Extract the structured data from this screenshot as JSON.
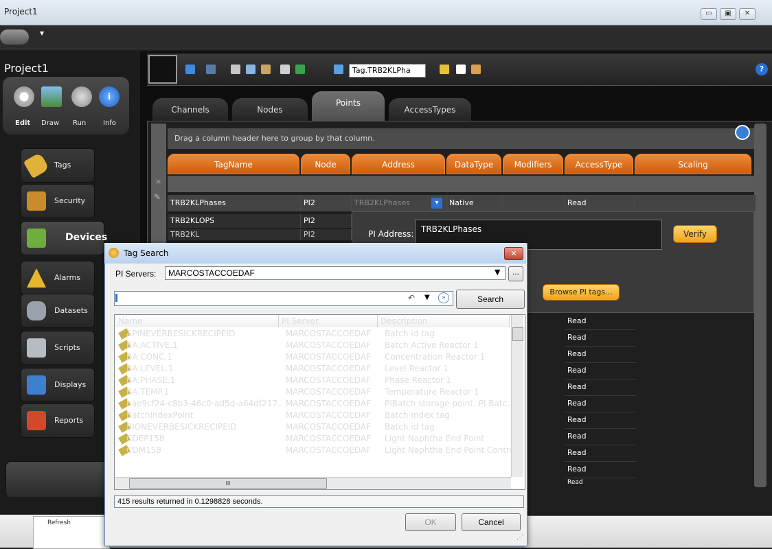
{
  "window": {
    "title": "Project1"
  },
  "sidebar": {
    "project_title": "Project1",
    "modes": [
      {
        "label": "Edit"
      },
      {
        "label": "Draw"
      },
      {
        "label": "Run"
      },
      {
        "label": "Info"
      }
    ],
    "items": [
      {
        "label": "Tags",
        "color": "#e2b13a"
      },
      {
        "label": "Security",
        "color": "#c88c2a"
      },
      {
        "label": "Devices",
        "color": "#6fae3c"
      },
      {
        "label": "Alarms",
        "color": "#e7b62d"
      },
      {
        "label": "Datasets",
        "color": "#9aa3ad"
      },
      {
        "label": "Scripts",
        "color": "#b7bcc2"
      },
      {
        "label": "Displays",
        "color": "#3f7fd0"
      },
      {
        "label": "Reports",
        "color": "#d04a2a"
      }
    ],
    "refresh_label": "Refresh"
  },
  "toolbar": {
    "tag_value": "Tag.TRB2KLPha",
    "help": "?"
  },
  "tabs": [
    {
      "label": "Channels"
    },
    {
      "label": "Nodes"
    },
    {
      "label": "Points",
      "active": true
    },
    {
      "label": "AccessTypes"
    }
  ],
  "grid": {
    "group_hint": "Drag a column header here to group by that column.",
    "columns": [
      "TagName",
      "Node",
      "Address",
      "DataType",
      "Modifiers",
      "AccessType",
      "Scaling"
    ],
    "clear_filter": "×",
    "rows": [
      {
        "tagname": "TRB2KLPhases",
        "node": "PI2",
        "address": "TRB2KLPhases",
        "datatype": "Native",
        "modifiers": "",
        "accesstype": "Read"
      },
      {
        "tagname": "TRB2KLOPS",
        "node": "PI2"
      },
      {
        "tagname": "TRB2KL",
        "node": "PI2"
      }
    ],
    "read_rows": [
      "Read",
      "Read",
      "Read",
      "Read",
      "Read",
      "Read",
      "Read",
      "Read",
      "Read",
      "Read",
      "Read"
    ]
  },
  "detail": {
    "pi_address_label": "PI Address:",
    "pi_address_value": "TRB2KLPhases",
    "verify_label": "Verify",
    "browse_label": "Browse PI tags..."
  },
  "dialog": {
    "title": "Tag Search",
    "close": "✕",
    "servers_label": "PI Servers:",
    "server_value": "MARCOSTACCOEDAF",
    "more": "...",
    "search_value": "",
    "search_label": "Search",
    "headers": [
      "Name",
      "PI Server",
      "Description"
    ],
    "results": [
      {
        "name": "APINEVERBESICKRECIPEID",
        "server": "MARCOSTACCOEDAF",
        "desc": "Batch id tag"
      },
      {
        "name": "BA:ACTIVE.1",
        "server": "MARCOSTACCOEDAF",
        "desc": "Batch Active Reactor 1"
      },
      {
        "name": "BA:CONC.1",
        "server": "MARCOSTACCOEDAF",
        "desc": "Concentration Reactor 1"
      },
      {
        "name": "BA:LEVEL.1",
        "server": "MARCOSTACCOEDAF",
        "desc": "Level Reactor 1"
      },
      {
        "name": "BA:PHASE.1",
        "server": "MARCOSTACCOEDAF",
        "desc": "Phase Reactor 1"
      },
      {
        "name": "BA:TEMP.1",
        "server": "MARCOSTACCOEDAF",
        "desc": "Temperature Reactor 1"
      },
      {
        "name": "bae9cf24-c8b3-46c0-ad5d-a64df217...",
        "server": "MARCOSTACCOEDAF",
        "desc": "PIBatch storage point. PI Batc..."
      },
      {
        "name": "BatchIndexPoint",
        "server": "MARCOSTACCOEDAF",
        "desc": "Batch Index tag"
      },
      {
        "name": "BIONEVERBESICKRECIPEID",
        "server": "MARCOSTACCOEDAF",
        "desc": "Batch id tag"
      },
      {
        "name": "CDEP158",
        "server": "MARCOSTACCOEDAF",
        "desc": "Light Naphtha End Point"
      },
      {
        "name": "CDM158",
        "server": "MARCOSTACCOEDAF",
        "desc": "Light Naphtha End Point Control"
      }
    ],
    "hscroll_grip": "III",
    "status": "415 results returned in 0.1298828 seconds.",
    "ok_label": "OK",
    "cancel_label": "Cancel"
  }
}
